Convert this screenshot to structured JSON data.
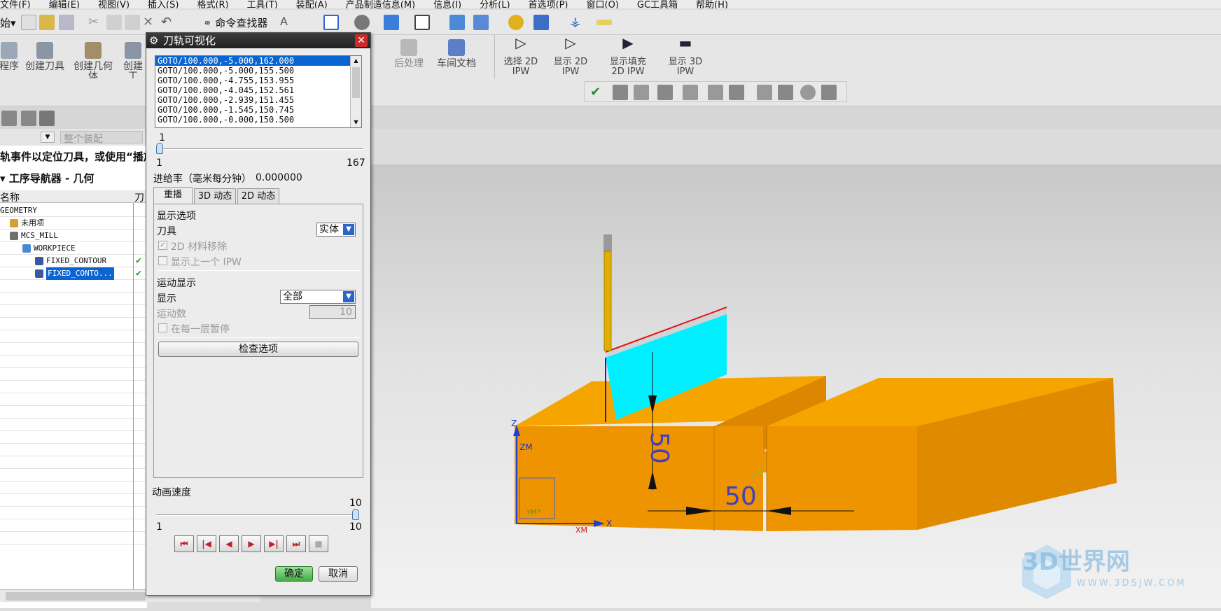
{
  "menu": [
    "文件(F)",
    "编辑(E)",
    "视图(V)",
    "插入(S)",
    "格式(R)",
    "工具(T)",
    "装配(A)",
    "产品制造信息(M)",
    "信息(I)",
    "分析(L)",
    "首选项(P)",
    "窗口(O)",
    "GC工具箱",
    "帮助(H)"
  ],
  "toolbar": {
    "start_label": "始▾",
    "command_finder": "命令查找器"
  },
  "ribbon": {
    "left_items": [
      "程序",
      "创建刀具",
      "创建几何体",
      "创建工"
    ],
    "middle_items": [
      "后处理",
      "车间文档"
    ],
    "ipw_items": [
      "选择 2D IPW",
      "显示 2D IPW",
      "显示填充 2D IPW",
      "显示 3D IPW"
    ]
  },
  "filter": {
    "scope": "整个装配"
  },
  "hint_text": "轨事件以定位刀具，或使用“播放",
  "navigator": {
    "title": "工序导航器 - 几何",
    "col_name": "名称",
    "col_tool": "刀",
    "rows": [
      {
        "label": "GEOMETRY",
        "indent": 0,
        "icon": "",
        "check": false,
        "selected": false
      },
      {
        "label": "未用项",
        "indent": 1,
        "icon": "folder-icon",
        "check": false,
        "selected": false
      },
      {
        "label": "MCS_MILL",
        "indent": 1,
        "icon": "mcs-icon",
        "check": false,
        "selected": false
      },
      {
        "label": "WORKPIECE",
        "indent": 2,
        "icon": "workpiece-icon",
        "check": false,
        "selected": false
      },
      {
        "label": "FIXED_CONTOUR",
        "indent": 3,
        "icon": "operation-icon",
        "check": true,
        "selected": false
      },
      {
        "label": "FIXED_CONTO...",
        "indent": 3,
        "icon": "operation-icon",
        "check": true,
        "selected": true
      }
    ]
  },
  "dialog": {
    "title": "刀轨可视化",
    "gotos": [
      "GOTO/100.000,-5.000,162.000",
      "GOTO/100.000,-5.000,155.500",
      "GOTO/100.000,-4.755,153.955",
      "GOTO/100.000,-4.045,152.561",
      "GOTO/100.000,-2.939,151.455",
      "GOTO/100.000,-1.545,150.745",
      "GOTO/100.000,-0.000,150.500"
    ],
    "position_current": "1",
    "position_min": "1",
    "position_max": "167",
    "position_fraction": 0.0,
    "feed_label": "进给率（毫米每分钟）",
    "feed_value": "0.000000",
    "tabs": [
      "重播",
      "3D 动态",
      "2D 动态"
    ],
    "display_options": "显示选项",
    "tool_label": "刀具",
    "tool_value": "实体",
    "material_removal_2d": "2D 材料移除",
    "show_previous_ipw": "显示上一个 IPW",
    "motion_display": "运动显示",
    "display_label": "显示",
    "display_value": "全部",
    "motion_count_label": "运动数",
    "motion_count_value": "10",
    "pause_each_layer": "在每一层暂停",
    "check_options": "检查选项",
    "speed_label": "动画速度",
    "speed_current": "10",
    "speed_min": "1",
    "speed_max": "10",
    "speed_fraction": 1.0,
    "ok": "确定",
    "cancel": "取消"
  },
  "viewport": {
    "dim_vertical": "50",
    "dim_horizontal": "50",
    "axis_z": "Z",
    "axis_zm": "ZM",
    "axis_x": "X",
    "axis_xm": "XM",
    "axis_ym": "YM",
    "axis_y": "Y",
    "part_color": "#f09a00",
    "path_color": "#00f0ff"
  },
  "watermark": {
    "brand": "3D世界网",
    "url": "WWW.3DSJW.COM"
  }
}
